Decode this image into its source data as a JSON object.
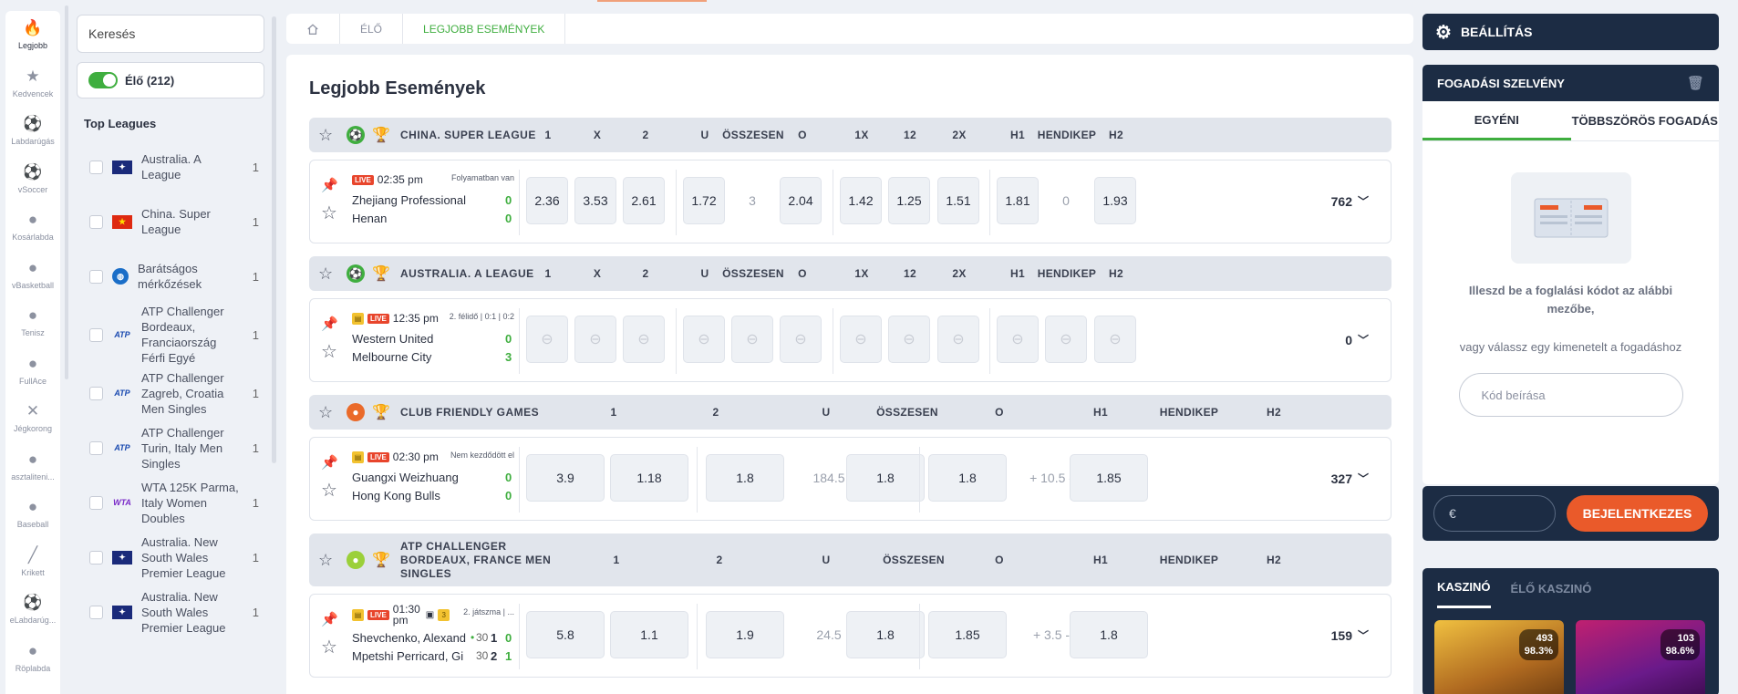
{
  "rail": [
    {
      "label": "Legjobb",
      "icon": "flame-icon",
      "glyph": "🔥",
      "active": true
    },
    {
      "label": "Kedvencek",
      "icon": "star-icon",
      "glyph": "★"
    },
    {
      "label": "Labdarúgás",
      "icon": "soccer-icon",
      "glyph": "⚽"
    },
    {
      "label": "vSoccer",
      "icon": "vsoccer-icon",
      "glyph": "⚽"
    },
    {
      "label": "Kosárlabda",
      "icon": "basketball-icon",
      "glyph": "●"
    },
    {
      "label": "vBasketball",
      "icon": "vbasketball-icon",
      "glyph": "●"
    },
    {
      "label": "Tenisz",
      "icon": "tennis-icon",
      "glyph": "●"
    },
    {
      "label": "FullAce",
      "icon": "fullace-icon",
      "glyph": "●"
    },
    {
      "label": "Jégkorong",
      "icon": "hockey-icon",
      "glyph": "✕"
    },
    {
      "label": "asztaliteni...",
      "icon": "table-tennis-icon",
      "glyph": "●"
    },
    {
      "label": "Baseball",
      "icon": "baseball-icon",
      "glyph": "●"
    },
    {
      "label": "Krikett",
      "icon": "cricket-icon",
      "glyph": "╱"
    },
    {
      "label": "eLabdarúg...",
      "icon": "esoccer-icon",
      "glyph": "⚽"
    },
    {
      "label": "Röplabda",
      "icon": "volleyball-icon",
      "glyph": "●"
    }
  ],
  "sidebar": {
    "search_placeholder": "Keresés",
    "live_label": "Élő (212)",
    "top_leagues_title": "Top Leagues",
    "leagues": [
      {
        "name": "Australia. A League",
        "count": "1",
        "flag": "au"
      },
      {
        "name": "China. Super League",
        "count": "1",
        "flag": "cn"
      },
      {
        "name": "Barátságos mérkőzések",
        "count": "1",
        "flag": "globe"
      },
      {
        "name": "ATP Challenger Bordeaux, Franciaország Férfi Egyé",
        "count": "1",
        "flag": "atp"
      },
      {
        "name": "ATP Challenger Zagreb, Croatia Men Singles",
        "count": "1",
        "flag": "atp"
      },
      {
        "name": "ATP Challenger Turin, Italy Men Singles",
        "count": "1",
        "flag": "atp"
      },
      {
        "name": "WTA 125K Parma, Italy Women Doubles",
        "count": "1",
        "flag": "wta"
      },
      {
        "name": "Australia. New South Wales Premier League",
        "count": "1",
        "flag": "au"
      },
      {
        "name": "Australia. New South Wales Premier League",
        "count": "1",
        "flag": "au"
      }
    ]
  },
  "breadcrumb": {
    "live": "ÉLŐ",
    "current": "LEGJOBB ESEMÉNYEK"
  },
  "page_title": "Legjobb Események",
  "sections": [
    {
      "title": "CHINA. SUPER LEAGUE",
      "cols": [
        "1",
        "X",
        "2",
        "U",
        "ÖSSZESEN",
        "O",
        "1X",
        "12",
        "2X",
        "H1",
        "HENDIKEP",
        "H2"
      ],
      "event": {
        "live": "LIVE",
        "time": "02:35 pm",
        "status": "Folyamatban van",
        "team1": "Zhejiang Professional",
        "team2": "Henan",
        "score1": "0",
        "score2": "0",
        "odds": [
          "2.36",
          "3.53",
          "2.61",
          "1.72",
          "3",
          "2.04",
          "1.42",
          "1.25",
          "1.51",
          "1.81",
          "0",
          "1.93"
        ],
        "more": "762"
      }
    },
    {
      "title": "AUSTRALIA. A LEAGUE",
      "cols": [
        "1",
        "X",
        "2",
        "U",
        "ÖSSZESEN",
        "O",
        "1X",
        "12",
        "2X",
        "H1",
        "HENDIKEP",
        "H2"
      ],
      "event": {
        "live": "LIVE",
        "time": "12:35 pm",
        "status": "2. félidő | 0:1 | 0:2",
        "team1": "Western United",
        "team2": "Melbourne City",
        "score1": "0",
        "score2": "3",
        "more": "0"
      }
    },
    {
      "title": "CLUB FRIENDLY GAMES",
      "cols": [
        "1",
        "2",
        "U",
        "ÖSSZESEN",
        "O",
        "H1",
        "HENDIKEP",
        "H2"
      ],
      "event": {
        "live": "LIVE",
        "time": "02:30 pm",
        "status": "Nem kezdődött el",
        "team1": "Guangxi Weizhuang",
        "team2": "Hong Kong Bulls",
        "score1": "0",
        "score2": "0",
        "odds": [
          "3.9",
          "1.18",
          "1.8",
          "184.5",
          "1.8",
          "1.8",
          "+ 10.5 -",
          "1.85"
        ],
        "more": "327"
      }
    },
    {
      "title": "ATP CHALLENGER BORDEAUX, FRANCE MEN SINGLES",
      "cols": [
        "1",
        "2",
        "U",
        "ÖSSZESEN",
        "O",
        "H1",
        "HENDIKEP",
        "H2"
      ],
      "event": {
        "live": "LIVE",
        "time": "01:30 pm",
        "badge": "3",
        "status": "2. játszma | ...",
        "team1": "Shevchenko, Alexand",
        "team2": "Mpetshi Perricard, Gi",
        "p1": "30",
        "g1": "1",
        "score1": "0",
        "p2": "30",
        "g2": "2",
        "score2": "1",
        "odds": [
          "5.8",
          "1.1",
          "1.9",
          "24.5",
          "1.8",
          "1.85",
          "+ 3.5 -",
          "1.8"
        ],
        "more": "159"
      }
    }
  ],
  "settings": {
    "label": "BEÁLLÍTÁS"
  },
  "betslip": {
    "title": "FOGADÁSI SZELVÉNY",
    "tab_single": "EGYÉNI",
    "tab_multi": "TÖBBSZÖRÖS FOGADÁS",
    "hint1": "Illeszd be a foglalási kódot az alábbi mezőbe,",
    "hint2": "vagy válassz egy kimenetelt a fogadáshoz",
    "code_placeholder": "Kód beírása"
  },
  "login": {
    "currency": "€",
    "button": "BEJELENTKEZES"
  },
  "casino": {
    "tab1": "KASZINÓ",
    "tab2": "ÉLŐ KASZINÓ",
    "games": [
      {
        "players": "493",
        "rtp": "98.3%"
      },
      {
        "players": "103",
        "rtp": "98.6%"
      }
    ]
  },
  "colors": {
    "accent": "#3fae3f",
    "live": "#e8452c",
    "navy": "#1c2c44",
    "orange": "#ea5a2a"
  }
}
